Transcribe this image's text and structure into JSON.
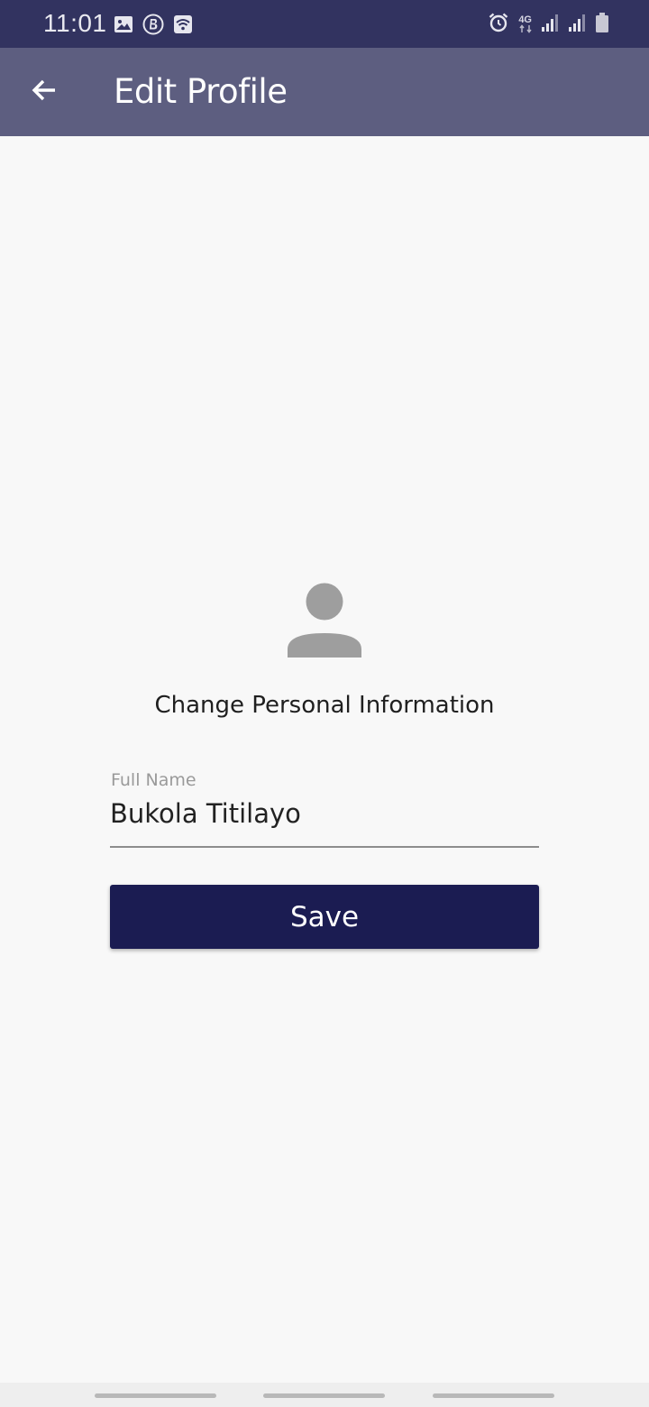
{
  "status_bar": {
    "time": "11:01",
    "network_type": "4G",
    "left_icons": [
      "gallery-icon",
      "b-app-icon",
      "wifi-icon"
    ],
    "right_icons": [
      "alarm-icon",
      "network-4g-icon",
      "signal-icon",
      "signal-icon",
      "battery-icon"
    ]
  },
  "app_bar": {
    "title": "Edit Profile",
    "back_icon": "arrow-left-icon"
  },
  "main": {
    "avatar_icon": "person-icon",
    "heading": "Change Personal Information",
    "full_name": {
      "label": "Full Name",
      "value": "Bukola Titilayo"
    },
    "save_label": "Save"
  },
  "colors": {
    "status_bar": "#323360",
    "app_bar": "#5d5e80",
    "primary_button": "#1b1c52",
    "background": "#f8f8f8",
    "avatar": "#9e9e9e"
  }
}
